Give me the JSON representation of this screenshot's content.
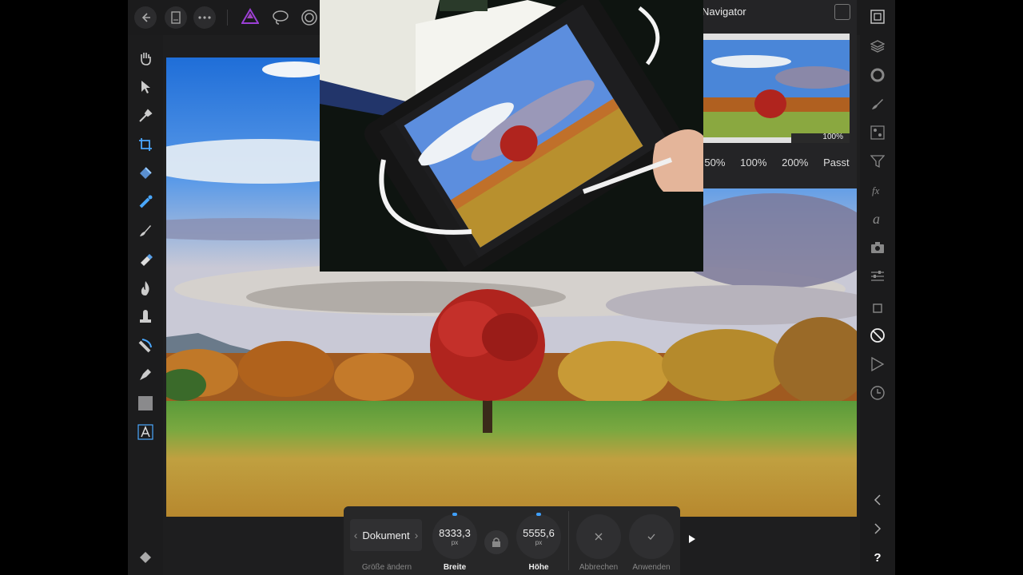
{
  "navigator": {
    "title": "Navigator",
    "thumb_zoom": "100%",
    "zoom_presets": [
      "50%",
      "100%",
      "200%",
      "Passt"
    ]
  },
  "context_bar": {
    "document_label": "Dokument",
    "resize_label": "Größe ändern",
    "width": {
      "value": "8333,3",
      "unit": "px",
      "label": "Breite"
    },
    "height": {
      "value": "5555,6",
      "unit": "px",
      "label": "Höhe"
    },
    "cancel_label": "Abbrechen",
    "apply_label": "Anwenden"
  },
  "colors": {
    "accent": "#3fa0ff",
    "affinity_logo": "#9b3fd6",
    "panel_bg": "#1e1e1f"
  },
  "icons": {
    "top": [
      "back-arrow-icon",
      "document-icon",
      "more-icon",
      "affinity-persona-icon",
      "lasso-icon",
      "liquify-icon"
    ],
    "left_tools": [
      "hand-icon",
      "move-icon",
      "eyedropper-icon",
      "crop-icon",
      "fill-icon",
      "selection-brush-icon",
      "paint-brush-icon",
      "eraser-icon",
      "burn-icon",
      "clone-icon",
      "healing-icon",
      "pen-icon",
      "rectangle-icon",
      "text-icon",
      "flood-fill-icon"
    ],
    "right_studio": [
      "navigator-icon",
      "layers-icon",
      "adjustments-icon",
      "brushes-icon",
      "channels-icon",
      "filters-icon",
      "fx-icon",
      "character-icon",
      "snapshot-icon",
      "tone-icon",
      "transform-icon",
      "navigator-compass-icon",
      "macro-icon",
      "history-icon",
      "prev-icon",
      "next-icon",
      "help-icon"
    ]
  },
  "help_label": "?"
}
